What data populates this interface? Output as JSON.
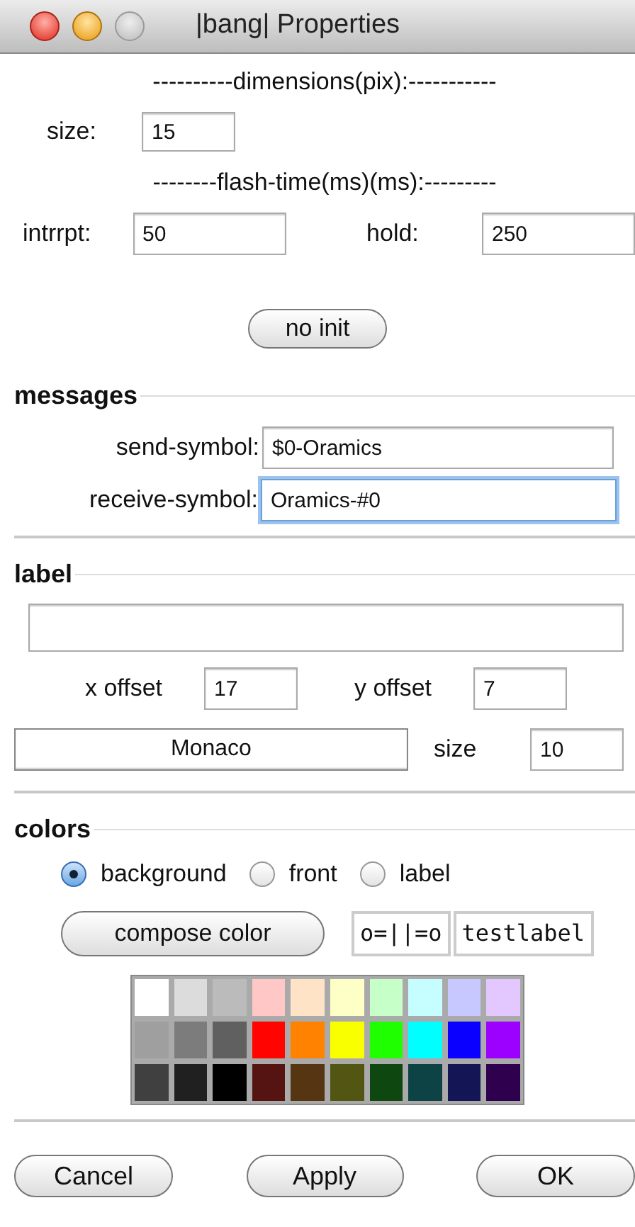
{
  "window": {
    "title": "|bang| Properties"
  },
  "dimensions": {
    "header": "----------dimensions(pix):-----------",
    "size_label": "size:",
    "size_value": "15"
  },
  "flash_time": {
    "header": "--------flash-time(ms)(ms):---------",
    "interrupt_label": "intrrpt:",
    "interrupt_value": "50",
    "hold_label": "hold:",
    "hold_value": "250"
  },
  "init_button": "no init",
  "messages": {
    "header": "messages",
    "send_label": "send-symbol:",
    "send_value": "$0-Oramics",
    "receive_label": "receive-symbol:",
    "receive_value": "Oramics-#0",
    "receive_focused": true
  },
  "label": {
    "header": "label",
    "x_label": "x offset",
    "x_value": "17",
    "y_label": "y offset",
    "y_value": "7",
    "font": "Monaco",
    "size_label": "size",
    "size_value": "10"
  },
  "colors": {
    "header": "colors",
    "targets": [
      {
        "label": "background",
        "selected": true
      },
      {
        "label": "front",
        "selected": false
      },
      {
        "label": "label",
        "selected": false
      }
    ],
    "compose_button": "compose color",
    "preview_symbol": "o=||=o",
    "preview_label": "testlabel",
    "swatches": [
      [
        {
          "color": "#ffffff"
        },
        {
          "color": "#dcdcdc"
        },
        {
          "color": "#bbbbbb"
        },
        {
          "color": "#ffc7c6"
        },
        {
          "color": "#ffe3c6"
        },
        {
          "color": "#feffc7"
        },
        {
          "color": "#c6ffc7"
        },
        {
          "color": "#c6feff"
        },
        {
          "color": "#c7c8ff"
        },
        {
          "color": "#e3c7ff"
        }
      ],
      [
        {
          "color": "#9f9f9f"
        },
        {
          "color": "#7c7c7c"
        },
        {
          "color": "#606060"
        },
        {
          "color": "#ff0400"
        },
        {
          "color": "#ff8300"
        },
        {
          "color": "#faff00"
        },
        {
          "color": "#1fff00"
        },
        {
          "color": "#00ffff"
        },
        {
          "color": "#0a00ff"
        },
        {
          "color": "#9c00ff"
        }
      ],
      [
        {
          "color": "#404040"
        },
        {
          "color": "#202020"
        },
        {
          "color": "#000000"
        },
        {
          "color": "#551312"
        },
        {
          "color": "#553512"
        },
        {
          "color": "#535512"
        },
        {
          "color": "#0f4710"
        },
        {
          "color": "#0e4345"
        },
        {
          "color": "#131555"
        },
        {
          "color": "#2f004d"
        }
      ]
    ]
  },
  "buttons": [
    "Cancel",
    "Apply",
    "OK"
  ]
}
